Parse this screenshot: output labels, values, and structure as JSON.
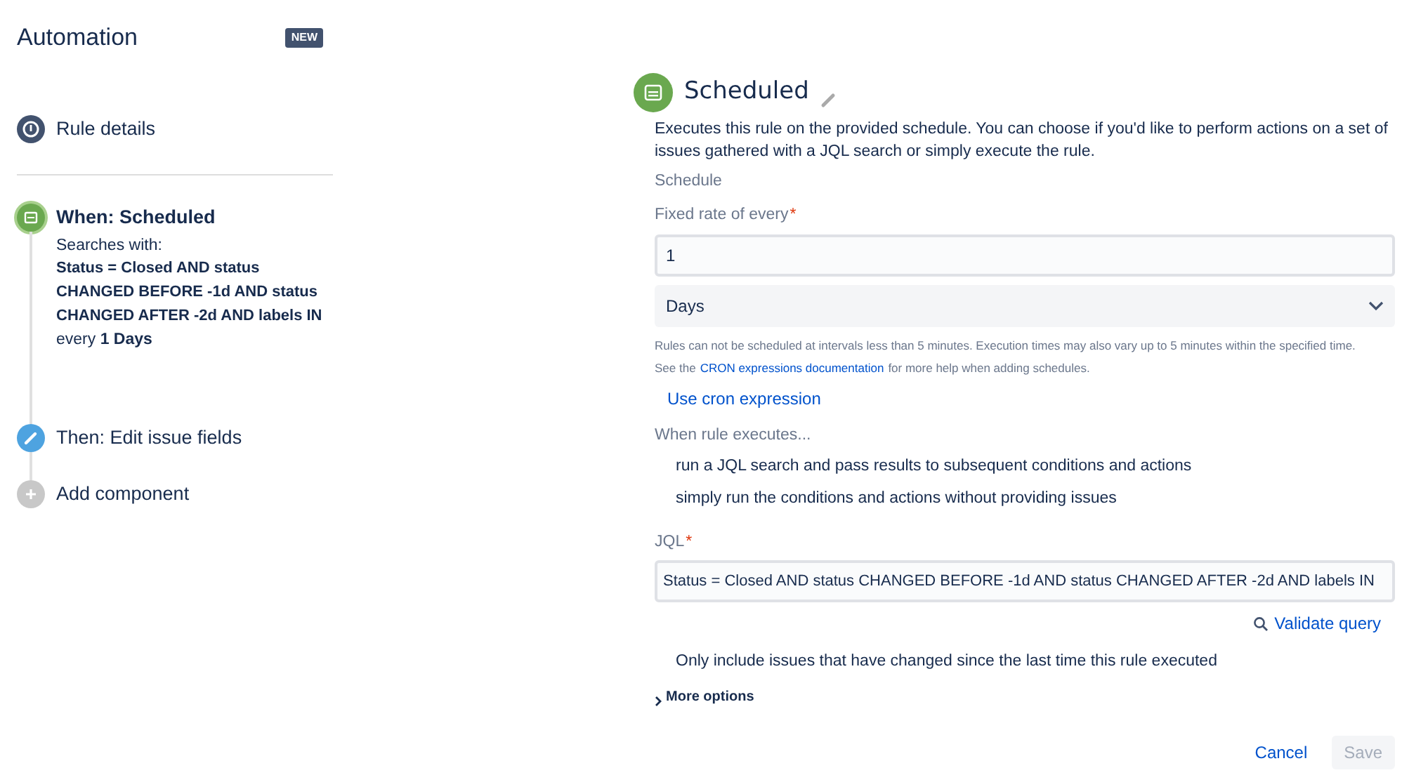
{
  "sidebar": {
    "title": "Automation",
    "badge": "NEW",
    "steps": [
      {
        "kind": "info",
        "title": "Rule details",
        "selected": false
      },
      {
        "kind": "scheduled",
        "title": "When: Scheduled",
        "selected": true,
        "label": "Searches with:",
        "query": "Status = Closed AND status CHANGED BEFORE -1d AND status CHANGED AFTER -2d AND labels IN",
        "every": "every **1 Days**"
      },
      {
        "kind": "edit",
        "title": "Then: Edit issue fields",
        "selected": false
      },
      {
        "kind": "add",
        "title": "Add component",
        "selected": false
      }
    ]
  },
  "panel": {
    "title": "Scheduled",
    "description": "Executes this rule on the provided schedule. You can choose if you'd like to perform actions on a set of issues gathered with a JQL search or simply execute the rule.",
    "section": "Schedule",
    "rate_label": "Fixed rate of every",
    "required_mark": "*",
    "rate_value": "1",
    "unit": "Days",
    "help_line": "Rules can not be scheduled at intervals less than 5 minutes. Execution times may also vary up to 5 minutes within the specified time.",
    "help_before": "See the",
    "help_link": "CRON expressions documentation",
    "help_after": "for more help when adding schedules.",
    "cron_link": "Use cron expression",
    "executes_label": "When rule executes...",
    "options": [
      "run a JQL search and pass results to subsequent conditions and actions",
      "simply run the conditions and actions without providing issues"
    ],
    "jql_label": "JQL",
    "jql_value": "Status = Closed AND status CHANGED BEFORE -1d AND status CHANGED AFTER -2d AND labels IN",
    "validate": "Validate query",
    "only_include": "Only include issues that have changed since the last time this rule executed",
    "more_options": "More options",
    "buttons": [
      {
        "label": "Cancel",
        "kind": "link",
        "disabled": false
      },
      {
        "label": "Save",
        "kind": "primary",
        "disabled": true
      }
    ]
  }
}
